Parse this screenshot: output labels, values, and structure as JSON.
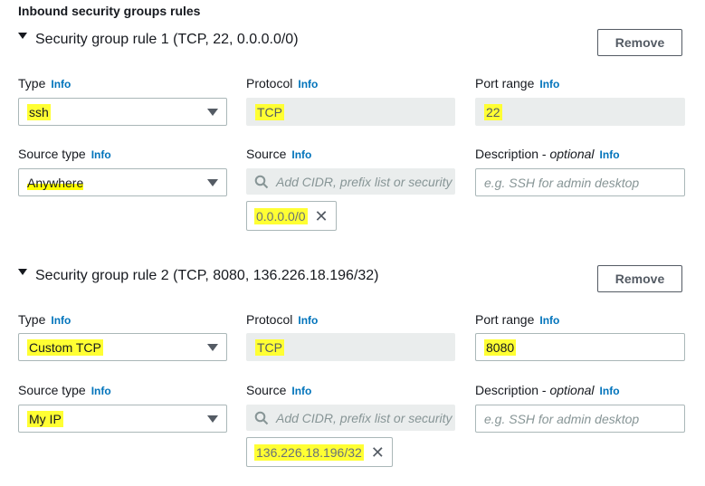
{
  "section": {
    "title": "Inbound security groups rules"
  },
  "labels": {
    "type": "Type",
    "protocol": "Protocol",
    "port_range": "Port range",
    "source_type": "Source type",
    "source": "Source",
    "description": "Description -",
    "description_optional": "optional",
    "info": "Info",
    "remove": "Remove",
    "source_placeholder": "Add CIDR, prefix list or security",
    "description_placeholder": "e.g. SSH for admin desktop"
  },
  "rules": [
    {
      "title": "Security group rule 1 (TCP, 22, 0.0.0.0/0)",
      "type": "ssh",
      "protocol": "TCP",
      "port_range": "22",
      "source_type": "Anywhere",
      "source_token": "0.0.0.0/0"
    },
    {
      "title": "Security group rule 2 (TCP, 8080, 136.226.18.196/32)",
      "type": "Custom TCP",
      "protocol": "TCP",
      "port_range": "8080",
      "source_type": "My IP",
      "source_token": "136.226.18.196/32"
    }
  ],
  "icons": {
    "search": "search-icon",
    "close": "close-icon",
    "caret": "caret-down-icon",
    "expand": "expand-caret-icon"
  },
  "colors": {
    "info_link": "#0073bb",
    "highlight": "#ffff00",
    "disabled_bg": "#eaeded",
    "border": "#aab7b8"
  }
}
